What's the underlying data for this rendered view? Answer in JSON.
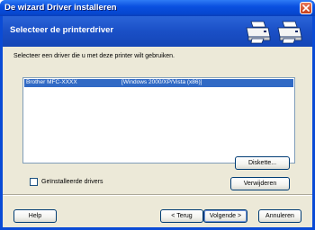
{
  "window": {
    "title": "De wizard Driver installeren"
  },
  "banner": {
    "title": "Selecteer de printerdriver",
    "icons": [
      "printer-icon",
      "printer-icon"
    ]
  },
  "instruction": "Selecteer een driver die u met deze printer wilt gebruiken.",
  "driver_list": {
    "rows": [
      {
        "name": "Brother MFC-XXXX",
        "platform": "[Windows 2000/XP/Vista (x86)]",
        "selected": true
      }
    ]
  },
  "checkbox": {
    "label": "Geïnstalleerde drivers",
    "checked": false
  },
  "buttons": {
    "disk": "Diskette...",
    "remove": "Verwijderen",
    "help": "Help",
    "back": "< Terug",
    "next": "Volgende >",
    "cancel": "Annuleren"
  },
  "colors": {
    "titlebar": "#0a50e0",
    "banner": "#1a4fc6",
    "client": "#ece9d8",
    "selection": "#316ac5"
  }
}
